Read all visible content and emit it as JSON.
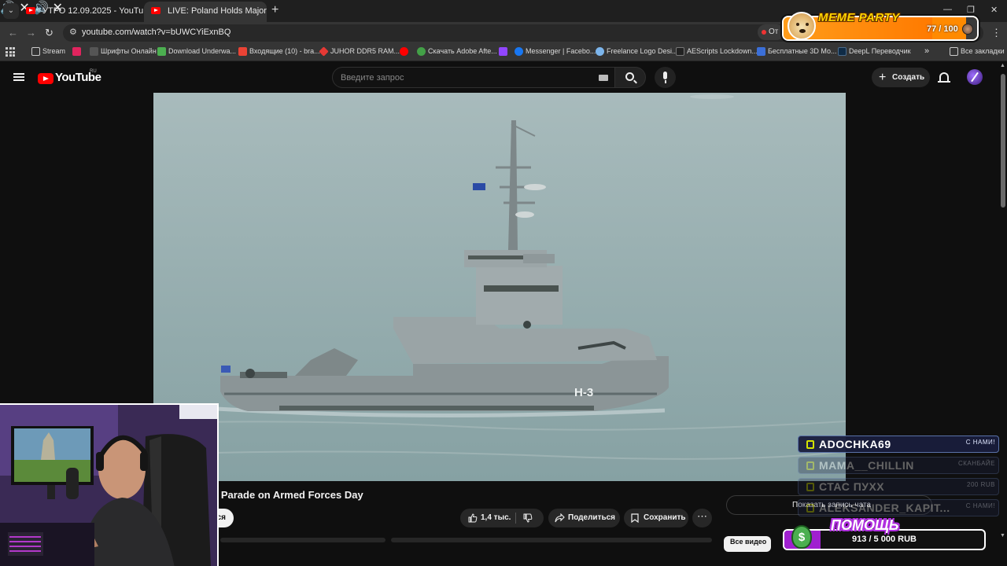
{
  "browser": {
    "tabs": [
      {
        "title": "УТРО 12.09.2025 - YouTube",
        "active": false
      },
      {
        "title": "LIVE: Poland Holds Major M",
        "active": true
      }
    ],
    "url": "youtube.com/watch?v=bUWCYiExnBQ",
    "omni_badge": "От",
    "bookmarks": [
      {
        "label": "Stream",
        "icon_color": "#9aa0a6"
      },
      {
        "label": "",
        "icon_color": "#e0245e"
      },
      {
        "label": "Шрифты Онлайн",
        "icon_color": "#555555"
      },
      {
        "label": "Download Underwa...",
        "icon_color": "#4caf50"
      },
      {
        "label": "Входящие (10) - bra...",
        "icon_color": "#ea4335"
      },
      {
        "label": "JUHOR DDR5 RAM...",
        "icon_color": "#e53935"
      },
      {
        "label": "",
        "icon_color": "#ff0000"
      },
      {
        "label": "Скачать Adobe Afte...",
        "icon_color": "#43a047"
      },
      {
        "label": "",
        "icon_color": "#9146ff"
      },
      {
        "label": "Messenger | Facebo...",
        "icon_color": "#1877f2"
      },
      {
        "label": "Freelance Logo Desi...",
        "icon_color": "#7cb5ec"
      },
      {
        "label": "AEScripts Lockdown...",
        "icon_color": "#222222"
      },
      {
        "label": "Бесплатные 3D Мо...",
        "icon_color": "#3b6fd8"
      },
      {
        "label": "DeepL Переводчик",
        "icon_color": "#0f2b46"
      }
    ],
    "all_bookmarks": "Все закладки"
  },
  "youtube": {
    "logo_text": "YouTube",
    "region": "RU",
    "search_placeholder": "Введите запрос",
    "create_label": "Создать"
  },
  "video": {
    "title_visible": "y Parade on Armed Forces Day",
    "hull_marking": "H-3",
    "subscribe_fragment": "ся",
    "likes": "1,4 тыс.",
    "share_label": "Поделиться",
    "save_label": "Сохранить",
    "show_chat": "Показать запись чата",
    "bottom_chip": "Все видео"
  },
  "overlay": {
    "meme_title": "MEME PARTY",
    "meme_count": "77 / 100",
    "meme_progress": 0.77,
    "donors": [
      {
        "name": "ADOCHKA69",
        "note": "С НАМИ!"
      },
      {
        "name": "MAMA__CHILLIN",
        "note": "СКАНБАЙЕ"
      },
      {
        "name": "СТАС ПУХХ",
        "note": "200 RUB"
      },
      {
        "name": "ALEKSANDER_KAPIT...",
        "note": "С НАМИ!"
      }
    ],
    "help_title": "ПОМОЩЬ",
    "help_amount": "913 / 5 000 RUB",
    "help_progress": 0.1826
  },
  "colors": {
    "brand_red": "#ff0000",
    "background": "#0f0f0f",
    "meme_orange": "#ff8a00",
    "help_purple": "#a020d0"
  }
}
